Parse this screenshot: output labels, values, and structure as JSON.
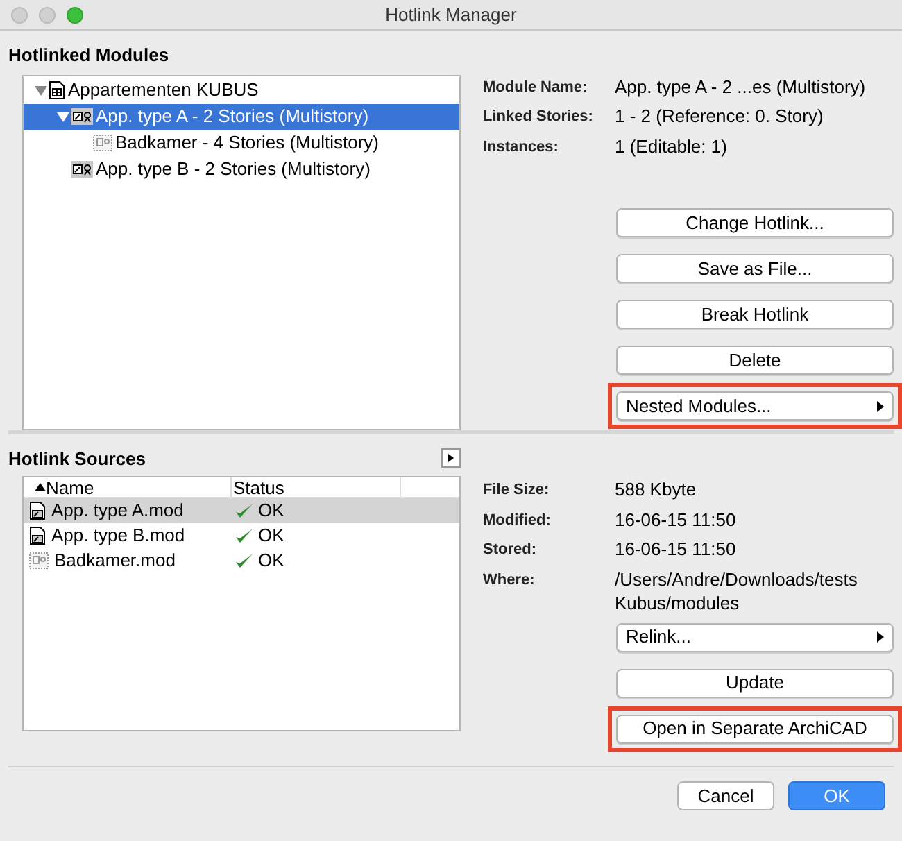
{
  "window": {
    "title": "Hotlink Manager"
  },
  "modules": {
    "heading": "Hotlinked Modules",
    "tree": [
      {
        "label": "Appartementen KUBUS",
        "kind": "project",
        "selected": false,
        "expanded": true,
        "children": [
          {
            "label": "App. type A - 2 Stories (Multistory)",
            "kind": "module",
            "selected": true,
            "expanded": true,
            "children": [
              {
                "label": "Badkamer - 4 Stories (Multistory)",
                "kind": "nested",
                "selected": false
              }
            ]
          },
          {
            "label": "App. type B - 2 Stories (Multistory)",
            "kind": "module",
            "selected": false
          }
        ]
      }
    ],
    "details": [
      {
        "label": "Module Name:",
        "value": "App. type A - 2 ...es (Multistory)"
      },
      {
        "label": "Linked Stories:",
        "value": "1 - 2 (Reference: 0. Story)"
      },
      {
        "label": "Instances:",
        "value": "1 (Editable: 1)"
      }
    ],
    "buttons": [
      {
        "label": "Change Hotlink...",
        "kind": "push",
        "highlighted": false
      },
      {
        "label": "Save as File...",
        "kind": "push",
        "highlighted": false
      },
      {
        "label": "Break Hotlink",
        "kind": "push",
        "highlighted": false
      },
      {
        "label": "Delete",
        "kind": "push",
        "highlighted": false
      },
      {
        "label": "Nested Modules...",
        "kind": "menu",
        "highlighted": true
      }
    ]
  },
  "sources": {
    "heading": "Hotlink Sources",
    "columns": [
      "Name",
      "Status"
    ],
    "rows": [
      {
        "name": "App. type A.mod",
        "status": "OK",
        "kind": "file",
        "selected": true
      },
      {
        "name": "App. type B.mod",
        "status": "OK",
        "kind": "file",
        "selected": false
      },
      {
        "name": "Badkamer.mod",
        "status": "OK",
        "kind": "nested",
        "selected": false
      }
    ],
    "details": [
      {
        "label": "File Size:",
        "value": "588 Kbyte"
      },
      {
        "label": "Modified:",
        "value": "16-06-15 11:50"
      },
      {
        "label": "Stored:",
        "value": "16-06-15 11:50"
      },
      {
        "label": "Where:",
        "value": "/Users/Andre/Downloads/tests Kubus/modules"
      }
    ],
    "buttons": [
      {
        "label": "Relink...",
        "kind": "menu",
        "highlighted": false
      },
      {
        "label": "Update",
        "kind": "push",
        "highlighted": false
      },
      {
        "label": "Open in Separate ArchiCAD",
        "kind": "push",
        "highlighted": true
      }
    ]
  },
  "footer": [
    {
      "label": "Cancel",
      "kind": "secondary"
    },
    {
      "label": "OK",
      "kind": "primary"
    }
  ]
}
